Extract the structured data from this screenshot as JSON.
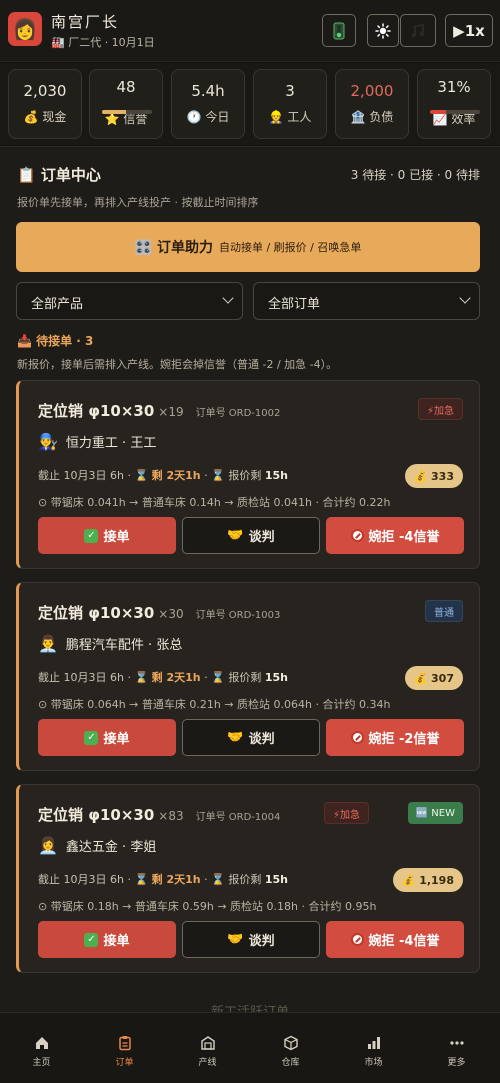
{
  "header": {
    "avatar_emoji": "👩",
    "title": "南宫厂长",
    "subtitle": "🏭 厂二代 · 10月1日",
    "buttons": {
      "speed_label": "▶1x"
    }
  },
  "stats": [
    {
      "icon": "💰",
      "label": "现金",
      "value": "2,030"
    },
    {
      "icon": "⭐",
      "label": "信誉",
      "value": "48",
      "bar": 0.48,
      "bar_color": "#e3b267"
    },
    {
      "icon": "🕐",
      "label": "今日",
      "value": "5.4h"
    },
    {
      "icon": "👷",
      "label": "工人",
      "value": "3"
    },
    {
      "icon": "🏦",
      "label": "负债",
      "value": "2,000",
      "value_color": "#e06b5e"
    },
    {
      "icon": "📈",
      "label": "效率",
      "value": "31%",
      "bar": 0.31,
      "bar_color": "#d9473a"
    }
  ],
  "orders_panel": {
    "title": "📋 订单中心",
    "counts": "3 待接 · 0 已接 · 0 待排",
    "subtitle": "报价单先接单，再排入产线投产 · 按截止时间排序",
    "helper_title": "🎛️ 订单助力",
    "helper_desc": "自动接单 / 刷报价 / 召唤急单",
    "filter_product": "全部产品",
    "filter_order": "全部订单",
    "pending_label": "📥 待接单 · 3",
    "pending_desc": "新报价，接单后需排入产线。婉拒会掉信誉（普通 -2 / 加急 -4）。",
    "next_section": "新工活跃订单"
  },
  "orders": [
    {
      "name": "定位销 φ10×30",
      "qty": "×19",
      "order_no": "订单号 ORD-1002",
      "tags": [
        {
          "text": "⚡加急",
          "type": "rush"
        }
      ],
      "customer_icon": "👨‍🔧",
      "customer": "恒力重工 · 王工",
      "deadline": "截止 10月3日 6h",
      "remain_prefix": "⌛ ",
      "remain": "剩 2天1h",
      "quote_prefix": "⌛ 报价剩 ",
      "quote": "15h",
      "price": "💰 333",
      "route": "⊙ 带锯床 0.041h → 普通车床 0.14h → 质检站 0.041h · 合计约 0.22h",
      "accept": "接单",
      "negotiate": "谈判",
      "reject": "婉拒 -4信誉"
    },
    {
      "name": "定位销 φ10×30",
      "qty": "×30",
      "order_no": "订单号 ORD-1003",
      "tags": [
        {
          "text": "普通",
          "type": "normal"
        }
      ],
      "customer_icon": "👨‍💼",
      "customer": "鹏程汽车配件 · 张总",
      "deadline": "截止 10月3日 6h",
      "remain_prefix": "⌛ ",
      "remain": "剩 2天1h",
      "quote_prefix": "⌛ 报价剩 ",
      "quote": "15h",
      "price": "💰 307",
      "route": "⊙ 带锯床 0.064h → 普通车床 0.21h → 质检站 0.064h · 合计约 0.34h",
      "accept": "接单",
      "negotiate": "谈判",
      "reject": "婉拒 -2信誉"
    },
    {
      "name": "定位销 φ10×30",
      "qty": "×83",
      "order_no": "订单号 ORD-1004",
      "tags": [
        {
          "text": "⚡加急",
          "type": "rush"
        },
        {
          "text": "🆕 NEW",
          "type": "new"
        }
      ],
      "customer_icon": "👩‍💼",
      "customer": "鑫达五金 · 李姐",
      "deadline": "截止 10月3日 6h",
      "remain_prefix": "⌛ ",
      "remain": "剩 2天1h",
      "quote_prefix": "⌛ 报价剩 ",
      "quote": "15h",
      "price": "💰 1,198",
      "route": "⊙ 带锯床 0.18h → 普通车床 0.59h → 质检站 0.18h · 合计约 0.95h",
      "accept": "接单",
      "negotiate": "谈判",
      "reject": "婉拒 -4信誉"
    }
  ],
  "nav": [
    {
      "label": "主页",
      "icon": "home-icon"
    },
    {
      "label": "订单",
      "icon": "clipboard-icon",
      "active": true
    },
    {
      "label": "产线",
      "icon": "factory-icon"
    },
    {
      "label": "仓库",
      "icon": "box-icon"
    },
    {
      "label": "市场",
      "icon": "bar-chart-icon"
    },
    {
      "label": "更多",
      "icon": "more-icon"
    }
  ]
}
